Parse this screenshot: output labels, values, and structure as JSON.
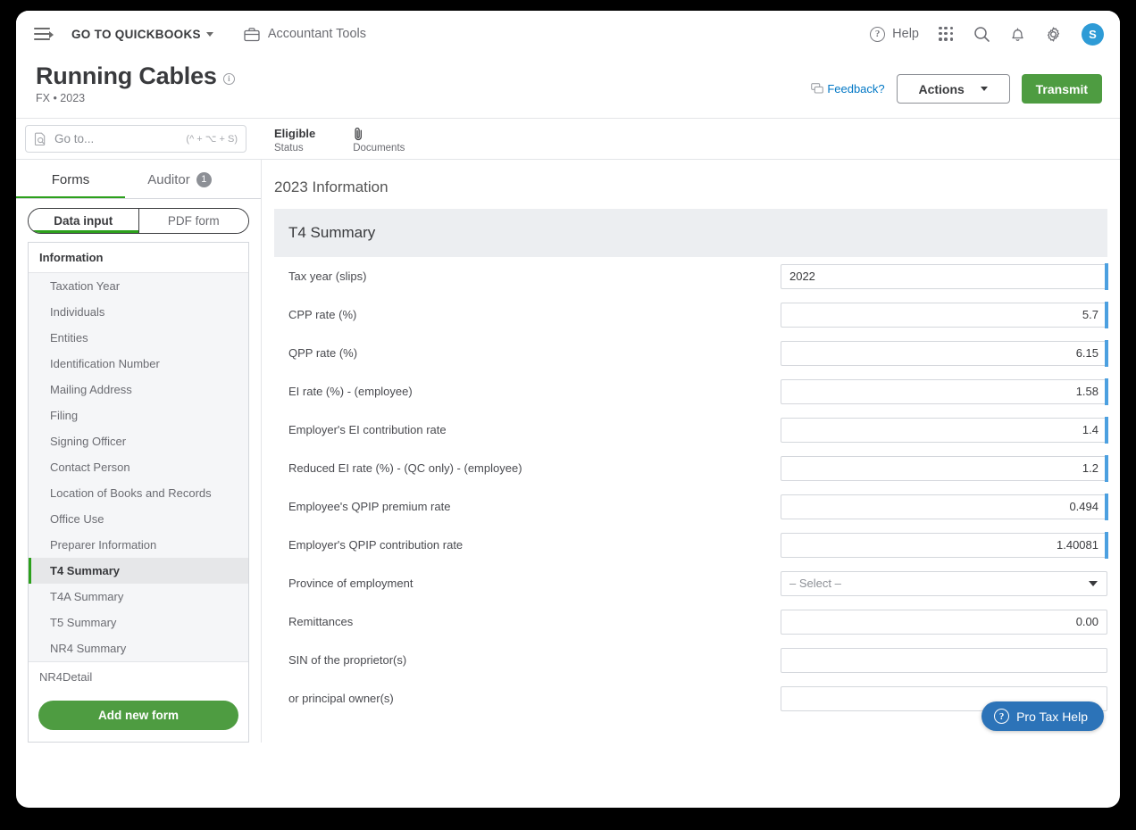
{
  "topbar": {
    "menu_icon": "hamburger-collapse-icon",
    "goto_quickbooks": "GO TO QUICKBOOKS",
    "accountant_tools": "Accountant Tools",
    "briefcase_icon": "briefcase-icon",
    "help": "Help",
    "grid_icon": "apps-grid-icon",
    "search_icon": "search-icon",
    "bell_icon": "notification-bell-icon",
    "gear_icon": "gear-icon",
    "avatar_initial": "S",
    "avatar_color": "#2e9bd6"
  },
  "title": {
    "heading": "Running Cables",
    "info_icon": "info-icon",
    "subtitle": "FX • 2023",
    "feedback": "Feedback?",
    "feedback_color": "#0077c5",
    "actions_label": "Actions",
    "transmit_label": "Transmit",
    "transmit_color": "#4e9c41"
  },
  "subheader": {
    "goto_placeholder": "Go to...",
    "goto_shortcut": "(^ + ⌥ + S)",
    "goto_icon": "document-search-icon",
    "status_value": "Eligible",
    "status_label": "Status",
    "documents_label": "Documents",
    "documents_icon": "paperclip-icon"
  },
  "sidebar": {
    "tabs": [
      {
        "label": "Forms",
        "active": true,
        "badge": ""
      },
      {
        "label": "Auditor",
        "active": false,
        "badge": "1"
      }
    ],
    "segmented": [
      {
        "label": "Data input",
        "active": true
      },
      {
        "label": "PDF form",
        "active": false
      }
    ],
    "group_header": "Information",
    "items": [
      {
        "label": "Taxation Year",
        "selected": false
      },
      {
        "label": "Individuals",
        "selected": false
      },
      {
        "label": "Entities",
        "selected": false
      },
      {
        "label": "Identification Number",
        "selected": false
      },
      {
        "label": "Mailing Address",
        "selected": false
      },
      {
        "label": "Filing",
        "selected": false
      },
      {
        "label": "Signing Officer",
        "selected": false
      },
      {
        "label": "Contact Person",
        "selected": false
      },
      {
        "label": "Location of Books and Records",
        "selected": false
      },
      {
        "label": "Office Use",
        "selected": false
      },
      {
        "label": "Preparer Information",
        "selected": false
      },
      {
        "label": "T4 Summary",
        "selected": true
      },
      {
        "label": "T4A Summary",
        "selected": false
      },
      {
        "label": "T5 Summary",
        "selected": false
      },
      {
        "label": "NR4 Summary",
        "selected": false
      }
    ],
    "section": "NR4Detail",
    "add_form_label": "Add new form",
    "accent_green": "#2ca01c"
  },
  "form": {
    "page_title": "2023 Information",
    "card_title": "T4 Summary",
    "fields": [
      {
        "label": "Tax year (slips)",
        "value": "2022",
        "type": "text",
        "align": "left",
        "marked": true
      },
      {
        "label": "CPP rate (%)",
        "value": "5.7",
        "type": "text",
        "align": "right",
        "marked": true
      },
      {
        "label": "QPP rate (%)",
        "value": "6.15",
        "type": "text",
        "align": "right",
        "marked": true
      },
      {
        "label": "EI rate (%) - (employee)",
        "value": "1.58",
        "type": "text",
        "align": "right",
        "marked": true
      },
      {
        "label": "Employer's EI contribution rate",
        "value": "1.4",
        "type": "text",
        "align": "right",
        "marked": true
      },
      {
        "label": "Reduced EI rate (%) - (QC only) - (employee)",
        "value": "1.2",
        "type": "text",
        "align": "right",
        "marked": true
      },
      {
        "label": "Employee's QPIP premium rate",
        "value": "0.494",
        "type": "text",
        "align": "right",
        "marked": true
      },
      {
        "label": "Employer's QPIP contribution rate",
        "value": "1.40081",
        "type": "text",
        "align": "right",
        "marked": true
      },
      {
        "label": "Province of employment",
        "value": "– Select –",
        "type": "select",
        "align": "left",
        "marked": false
      },
      {
        "label": "Remittances",
        "value": "0.00",
        "type": "text",
        "align": "right",
        "marked": false
      },
      {
        "label": "SIN of the proprietor(s)",
        "value": "",
        "type": "text",
        "align": "left",
        "marked": false
      },
      {
        "label": "or principal owner(s)",
        "value": "",
        "type": "text",
        "align": "left",
        "marked": false
      }
    ],
    "marker_color": "#4ca0e0"
  },
  "protax": {
    "label": "Pro Tax Help",
    "icon": "question-circle-icon",
    "color": "#2c73b8"
  }
}
